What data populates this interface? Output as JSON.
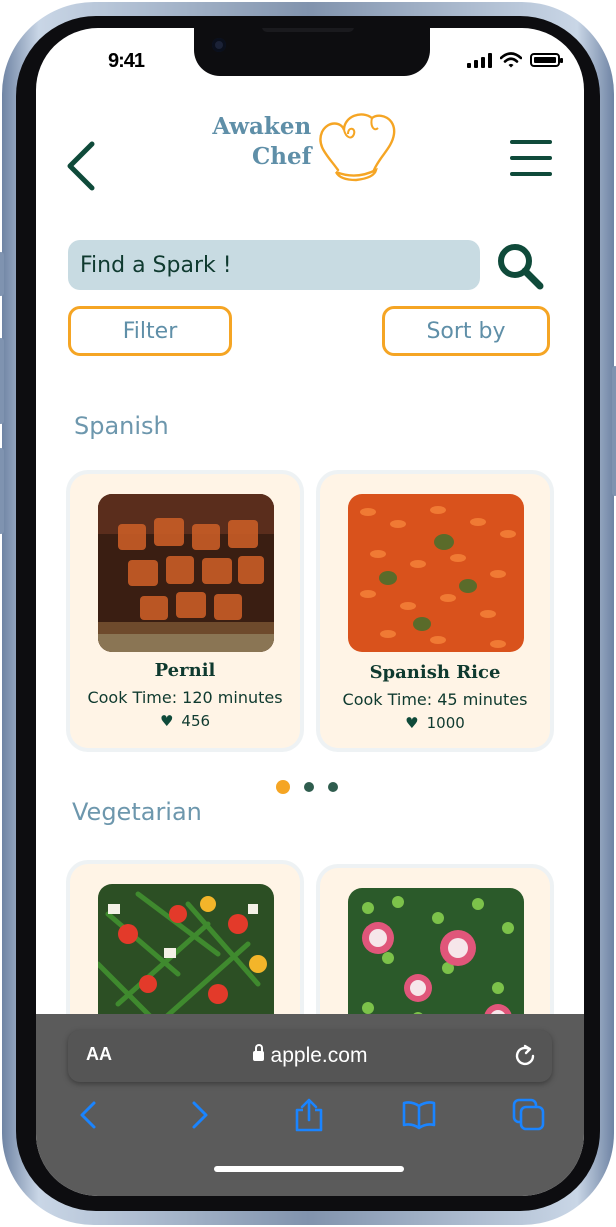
{
  "status_bar": {
    "time": "9:41"
  },
  "logo": {
    "line1": "Awaken",
    "line2": "Chef"
  },
  "search": {
    "placeholder": "Find a Spark !"
  },
  "buttons": {
    "filter": "Filter",
    "sort": "Sort by"
  },
  "sections": [
    {
      "title": "Spanish",
      "cards": [
        {
          "name": "Pernil",
          "cook_time": "Cook Time:  120 minutes",
          "likes": "456"
        },
        {
          "name": "Spanish Rice",
          "cook_time": "Cook Time:  45 minutes",
          "likes": "1000"
        }
      ]
    },
    {
      "title": "Vegetarian"
    }
  ],
  "carousel": {
    "pages": 3,
    "active": 0
  },
  "browser": {
    "aa_label": "AA",
    "url": "apple.com"
  },
  "colors": {
    "accent_orange": "#f5a524",
    "dark_green": "#0f4a3a",
    "muted_blue": "#5f8fa8",
    "search_bg": "#c8dbe2",
    "card_bg": "#fff4e6",
    "safari_bar": "#5b5b5b"
  },
  "icons": {
    "back": "chevron-left-icon",
    "menu": "hamburger-menu-icon",
    "search": "search-icon",
    "like": "heart-icon",
    "browser": [
      "chevron-left-icon",
      "chevron-right-icon",
      "share-icon",
      "bookmarks-icon",
      "tabs-icon",
      "reload-icon",
      "lock-icon"
    ]
  }
}
